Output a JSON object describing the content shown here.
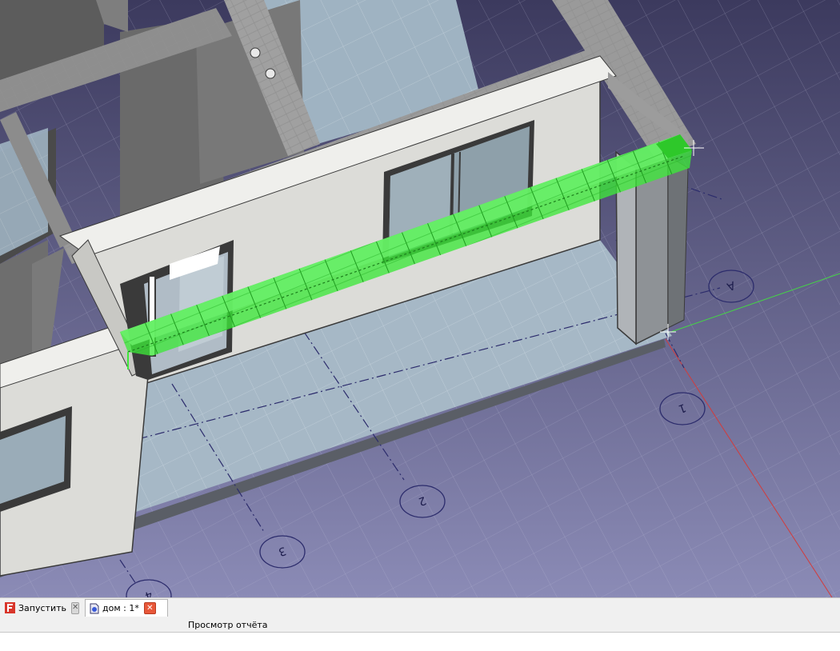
{
  "viewport": {
    "grid_labels": [
      "A",
      "1",
      "2",
      "3",
      "4"
    ]
  },
  "tabs": [
    {
      "label": "Запустить",
      "icon": "freecad-logo-icon",
      "active": false
    },
    {
      "label": "дом : 1*",
      "icon": "document-icon",
      "active": true
    }
  ],
  "close_glyph": "✕",
  "panel": {
    "report_view_label": "Просмотр отчёта"
  },
  "colors": {
    "background_top": "#3c3a5e",
    "background_bottom": "#8b8bb6",
    "selection_green": "#3ee83a",
    "axis_red": "#d23c3c",
    "axis_green": "#44d844",
    "wall": "#dcdcd8",
    "floor": "#a6b8c6"
  }
}
